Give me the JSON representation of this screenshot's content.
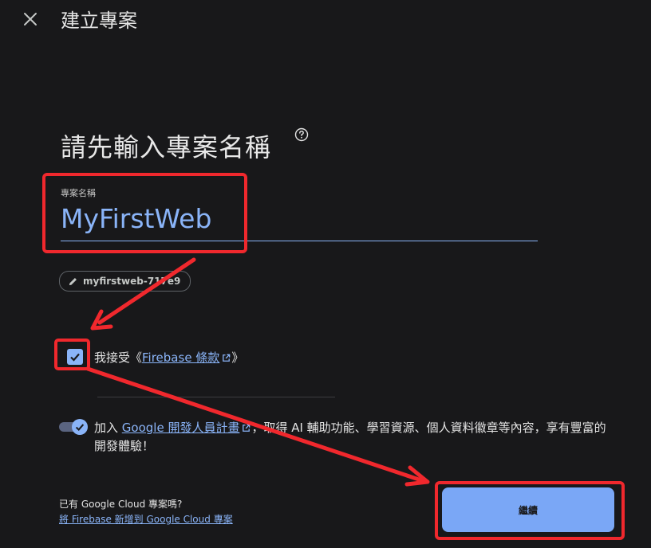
{
  "header": {
    "title": "建立專案",
    "close_icon": "close-icon"
  },
  "main": {
    "heading": "請先輸入專案名稱",
    "help_icon": "help-circle-icon",
    "project_name_field": {
      "label": "專案名稱",
      "value": "MyFirstWeb"
    },
    "project_id_chip": {
      "icon": "pencil-icon",
      "text": "myfirstweb-717e9"
    },
    "terms": {
      "checked": true,
      "prefix": "我接受《",
      "link": "Firebase 條款",
      "suffix": "》",
      "link_icon": "external-link-icon"
    },
    "developer_program": {
      "enabled": true,
      "prefix": "加入 ",
      "link": "Google 開發人員計畫",
      "link_icon": "external-link-icon",
      "suffix": "，取得 AI 輔助功能、學習資源、個人資料徽章等內容，享有豐富的開發體驗！"
    }
  },
  "footer": {
    "question": "已有 Google Cloud 專案嗎?",
    "link": "將 Firebase 新增到 Google Cloud 專案",
    "continue_label": "繼續"
  },
  "colors": {
    "background": "#18181a",
    "accent": "#8ab4f8",
    "annotation": "#f0282d"
  }
}
